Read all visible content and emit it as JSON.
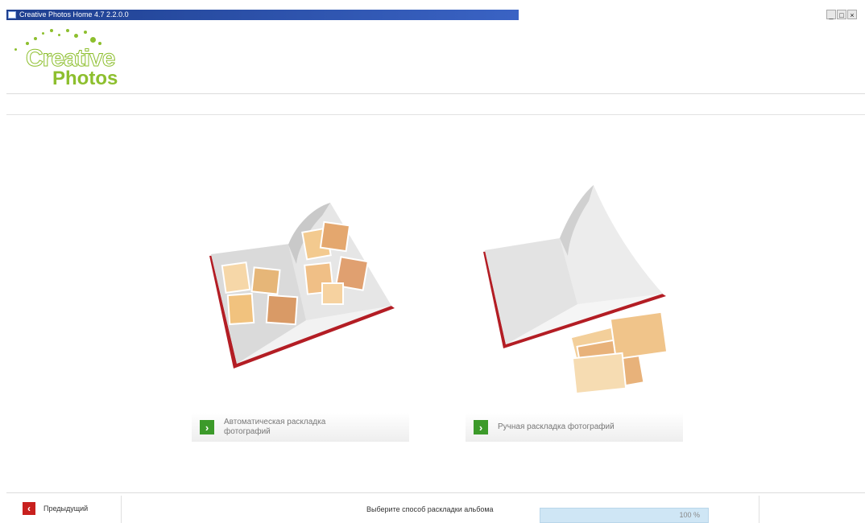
{
  "window": {
    "title": "Creative Photos Home 4.7 2.2.0.0",
    "controls": [
      "_",
      "□",
      "×"
    ]
  },
  "logo": {
    "line1": "Creative",
    "line2": "Photos",
    "color": "#8dbf2e"
  },
  "options": {
    "automatic": {
      "label": "Автоматическая раскладка фотографий",
      "icon": "arrow-right-icon"
    },
    "manual": {
      "label": "Ручная раскладка фотографий",
      "icon": "arrow-right-icon"
    }
  },
  "footer": {
    "back_label": "Предыдущий",
    "status": "Выберите способ раскладки альбома",
    "progress_text": "100 %"
  },
  "colors": {
    "accent_green": "#3c9a2a",
    "back_red": "#c8201e",
    "progress_bg": "#cfe6f5"
  }
}
